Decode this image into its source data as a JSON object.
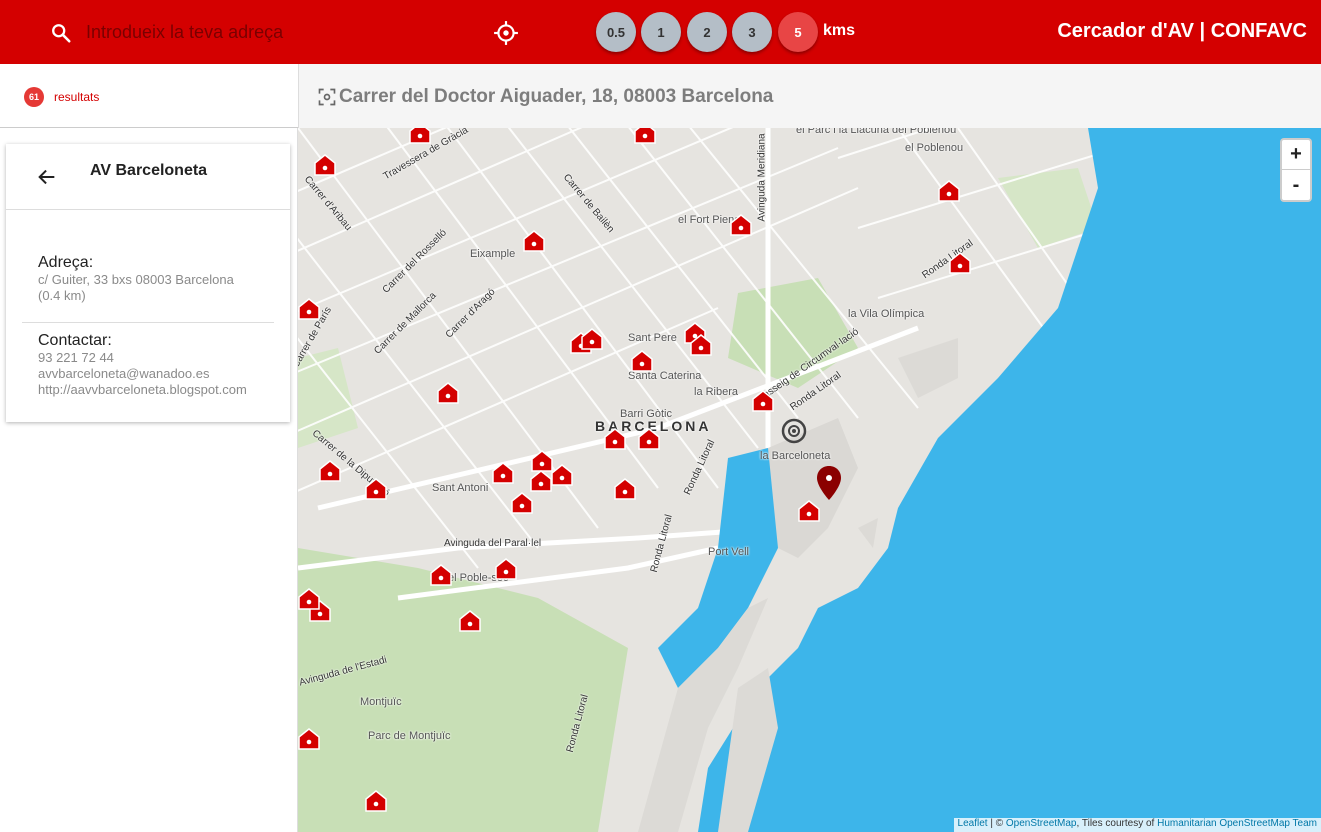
{
  "header": {
    "search_placeholder": "Introdueix la teva adreça",
    "radius_options": [
      "0.5",
      "1",
      "2",
      "3",
      "5"
    ],
    "radius_selected": "5",
    "radius_unit": "kms",
    "app_title": "Cercador d'AV | CONFAVC"
  },
  "results": {
    "count": "61",
    "label": "resultats"
  },
  "address_bar": {
    "address": "Carrer del Doctor Aiguader, 18, 08003 Barcelona"
  },
  "detail": {
    "title": "AV Barceloneta",
    "address_label": "Adreça:",
    "address_value": "c/ Guiter, 33 bxs 08003 Barcelona",
    "distance": "(0.4 km)",
    "contact_label": "Contactar:",
    "phone": "93 221 72 44",
    "email": "avvbarceloneta@wanadoo.es",
    "website": "http://aavvbarceloneta.blogspot.com"
  },
  "map": {
    "place_labels": [
      "el Parc i la Llacuna del Poblenou",
      "el Poblenou",
      "el Fort Pienc",
      "Eixample",
      "Sant Pere",
      "Santa Caterina",
      "la Ribera",
      "la Vila Olímpica",
      "Barri Gòtic",
      "BARCELONA",
      "la Barceloneta",
      "Sant Antoni",
      "Port Vell",
      "el Poble-sec",
      "Montjuïc",
      "Parc de Montjuïc"
    ],
    "road_labels": [
      "Travessera de Gràcia",
      "Carrer d'Aribau",
      "Carrer de Bailèn",
      "Avinguda Meridiana",
      "Carrer del Rosselló",
      "Carrer de Mallorca",
      "Carrer d'Aragó",
      "Passeig de Circumval·lació",
      "Ronda Litoral",
      "Carrer de la Diputació",
      "Avinguda del Paral·lel",
      "Avinguda de l'Estadi",
      "Carrer de París"
    ],
    "zoom_in": "+",
    "zoom_out": "-",
    "attribution": {
      "leaflet": "Leaflet",
      "sep": " | © ",
      "osm": "OpenStreetMap",
      "tiles": ", Tiles courtesy of ",
      "hot": "Humanitarian OpenStreetMap Team"
    },
    "colors": {
      "sea": "#3db5ea",
      "land": "#e6e4e0",
      "park": "#c8dfb6",
      "marker": "#d40000",
      "selected_pin": "#8b0000"
    },
    "association_markers_count": 33
  }
}
